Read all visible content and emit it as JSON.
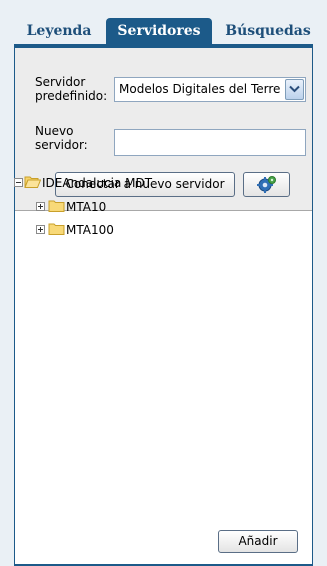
{
  "tabs": [
    {
      "label": "Leyenda"
    },
    {
      "label": "Servidores"
    },
    {
      "label": "Búsquedas"
    }
  ],
  "form": {
    "server_label": "Servidor predefinido:",
    "server_value": "Modelos Digitales del Terre",
    "new_server_label": "Nuevo servidor:",
    "new_server_value": "",
    "connect_button": "Conectar a nuevo servidor",
    "gear_icon": "gear-icon"
  },
  "tree": {
    "root": {
      "label": "IDEAndalucia MDT"
    },
    "children": [
      {
        "label": "MTA10"
      },
      {
        "label": "MTA100"
      }
    ]
  },
  "actions": {
    "add_button": "Añadir"
  },
  "colors": {
    "accent": "#1c5a89",
    "tab_text": "#1e4f7a",
    "form_background": "#ececec"
  }
}
